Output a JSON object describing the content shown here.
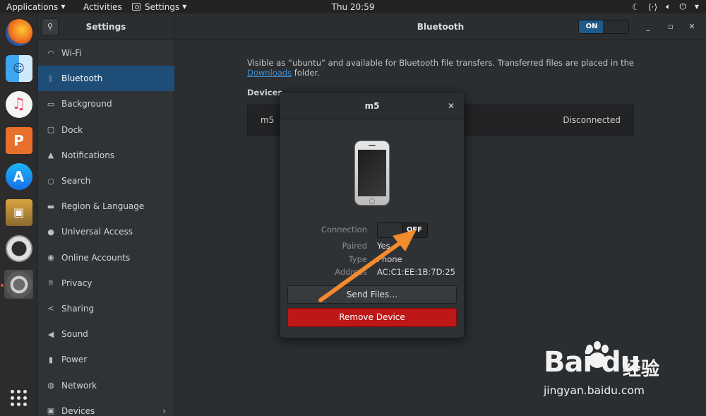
{
  "topbar": {
    "applications": "Applications",
    "activities": "Activities",
    "settings_menu": "Settings",
    "clock": "Thu 20:59"
  },
  "sidebar": {
    "title": "Settings",
    "items": [
      {
        "label": "Wi-Fi",
        "icon": "wifi-icon"
      },
      {
        "label": "Bluetooth",
        "icon": "bluetooth-icon",
        "active": true
      },
      {
        "label": "Background",
        "icon": "background-icon"
      },
      {
        "label": "Dock",
        "icon": "dock-icon"
      },
      {
        "label": "Notifications",
        "icon": "bell-icon"
      },
      {
        "label": "Search",
        "icon": "search-icon"
      },
      {
        "label": "Region & Language",
        "icon": "region-icon"
      },
      {
        "label": "Universal Access",
        "icon": "accessibility-icon"
      },
      {
        "label": "Online Accounts",
        "icon": "cloud-icon"
      },
      {
        "label": "Privacy",
        "icon": "hand-icon"
      },
      {
        "label": "Sharing",
        "icon": "share-icon"
      },
      {
        "label": "Sound",
        "icon": "speaker-icon"
      },
      {
        "label": "Power",
        "icon": "power-icon"
      },
      {
        "label": "Network",
        "icon": "network-icon"
      },
      {
        "label": "Devices",
        "icon": "devices-icon"
      }
    ]
  },
  "header": {
    "title": "Bluetooth",
    "toggle_label": "ON"
  },
  "main": {
    "visible_text_prefix": "Visible as “ubuntu” and available for Bluetooth file transfers. Transferred files are placed in the ",
    "downloads_link": "Downloads",
    "visible_text_suffix": " folder.",
    "devices_label": "Devices",
    "device": {
      "name": "m5",
      "status": "Disconnected"
    }
  },
  "dialog": {
    "title": "m5",
    "connection_label": "Connection",
    "connection_toggle": "OFF",
    "paired_label": "Paired",
    "paired_value": "Yes",
    "type_label": "Type",
    "type_value": "Phone",
    "address_label": "Address",
    "address_value": "AC:C1:EE:1B:7D:25",
    "send_files": "Send Files…",
    "remove_device": "Remove Device"
  },
  "watermark": {
    "logo_text": "Bai du",
    "cn_text": "经验",
    "url": "jingyan.baidu.com"
  },
  "colors": {
    "accent_blue": "#1e4e78",
    "toggle_on": "#1f5a8c",
    "remove_red": "#bd1717",
    "arrow_orange": "#f28a2e",
    "ubuntu_orange": "#e95420"
  }
}
